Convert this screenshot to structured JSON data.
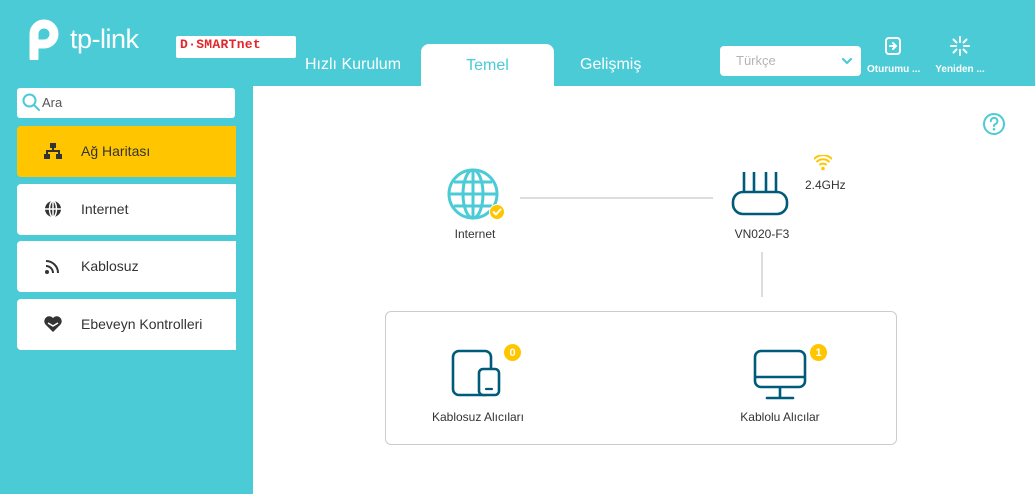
{
  "header": {
    "brand": "tp-link",
    "partner_logo": "D·SMARTnet",
    "tabs": [
      {
        "label": "Hızlı Kurulum",
        "active": false
      },
      {
        "label": "Temel",
        "active": true
      },
      {
        "label": "Gelişmiş",
        "active": false
      }
    ],
    "language": {
      "selected": "Türkçe",
      "icon": "chevron-down-icon"
    },
    "logout": {
      "label": "Oturumu ...",
      "icon": "logout-icon"
    },
    "reboot": {
      "label": "Yeniden ...",
      "icon": "reboot-icon"
    }
  },
  "sidebar": {
    "search": {
      "placeholder": "Ara",
      "icon": "search-icon"
    },
    "items": [
      {
        "label": "Ağ Haritası",
        "icon": "network-map-icon",
        "active": true
      },
      {
        "label": "Internet",
        "icon": "globe-icon",
        "active": false
      },
      {
        "label": "Kablosuz",
        "icon": "wireless-icon",
        "active": false
      },
      {
        "label": "Ebeveyn Kontrolleri",
        "icon": "heart-icon",
        "active": false
      }
    ]
  },
  "main": {
    "help_icon": "question-icon",
    "internet": {
      "label": "Internet",
      "status": "connected"
    },
    "router": {
      "label": "VN020-F3",
      "band": "2.4GHz"
    },
    "clients": {
      "wireless": {
        "label": "Kablosuz Alıcıları",
        "count": "0"
      },
      "wired": {
        "label": "Kablolu Alıcılar",
        "count": "1"
      }
    }
  },
  "colors": {
    "teal": "#4acbd6",
    "active_yellow": "#ffc600",
    "text": "#333333"
  }
}
